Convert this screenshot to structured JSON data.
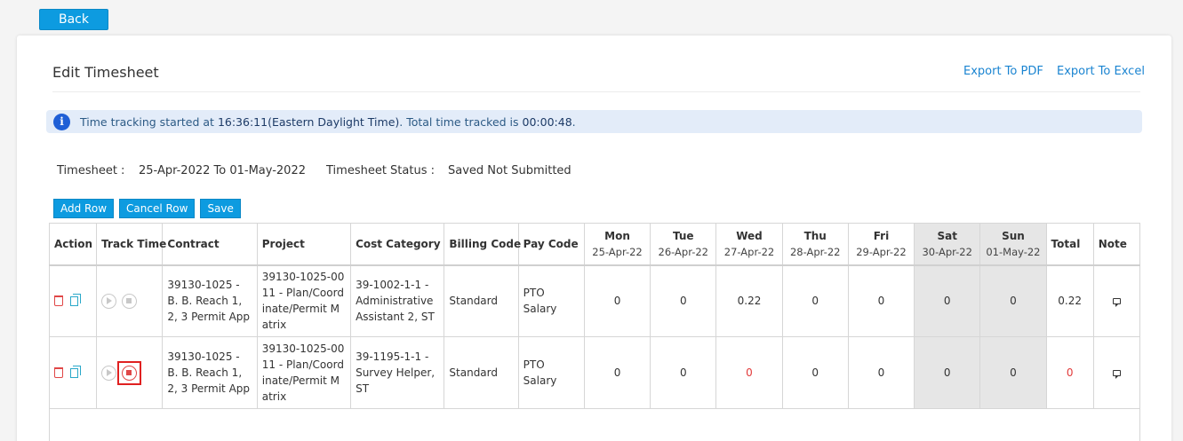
{
  "back_label": "Back",
  "page_title": "Edit Timesheet",
  "export": {
    "pdf": "Export To PDF",
    "excel": "Export To Excel"
  },
  "alert": {
    "prefix": "Time tracking started at ",
    "start_time": "16:36:11(Eastern Daylight Time)",
    "middle": ". Total time tracked is ",
    "total": "00:00:48",
    "suffix": "."
  },
  "meta": {
    "timesheet_label": "Timesheet :",
    "timesheet_value": "25-Apr-2022 To 01-May-2022",
    "status_label": "Timesheet Status :",
    "status_value": "Saved Not Submitted"
  },
  "buttons": {
    "add_row": "Add Row",
    "cancel_row": "Cancel Row",
    "save": "Save"
  },
  "columns": {
    "action": "Action",
    "track_time": "Track Time",
    "contract": "Contract",
    "project": "Project",
    "cost_category": "Cost Category",
    "billing_code": "Billing Code",
    "pay_code": "Pay Code",
    "total": "Total",
    "note": "Note"
  },
  "days": [
    {
      "name": "Mon",
      "date": "25-Apr-22"
    },
    {
      "name": "Tue",
      "date": "26-Apr-22"
    },
    {
      "name": "Wed",
      "date": "27-Apr-22"
    },
    {
      "name": "Thu",
      "date": "28-Apr-22"
    },
    {
      "name": "Fri",
      "date": "29-Apr-22"
    },
    {
      "name": "Sat",
      "date": "30-Apr-22"
    },
    {
      "name": "Sun",
      "date": "01-May-22"
    }
  ],
  "rows": [
    {
      "contract": "39130-1025 - B. B. Reach 1, 2, 3 Permit App",
      "project": "39130-1025-0011 - Plan/Coordinate/Permit Matrix",
      "cost_category": "39-1002-1-1 - Administrative Assistant 2, ST",
      "billing_code": "Standard",
      "pay_code": "PTO Salary",
      "hours": [
        "0",
        "0",
        "0.22",
        "0",
        "0",
        "0",
        "0"
      ],
      "total": "0.22"
    },
    {
      "contract": "39130-1025 - B. B. Reach 1, 2, 3 Permit App",
      "project": "39130-1025-0011 - Plan/Coordinate/Permit Matrix",
      "cost_category": "39-1195-1-1 - Survey Helper, ST",
      "billing_code": "Standard",
      "pay_code": "PTO Salary",
      "hours": [
        "0",
        "0",
        "0",
        "0",
        "0",
        "0",
        "0"
      ],
      "total": "0"
    }
  ],
  "colors": {
    "primary": "#0d9be0",
    "link": "#1a84d1",
    "danger": "#e04747",
    "weekend_bg": "#e6e6e6",
    "alert_bg": "#e3ecf9"
  },
  "icons": [
    "delete-icon",
    "copy-icon",
    "play-icon",
    "stop-icon",
    "note-icon",
    "info-icon"
  ]
}
